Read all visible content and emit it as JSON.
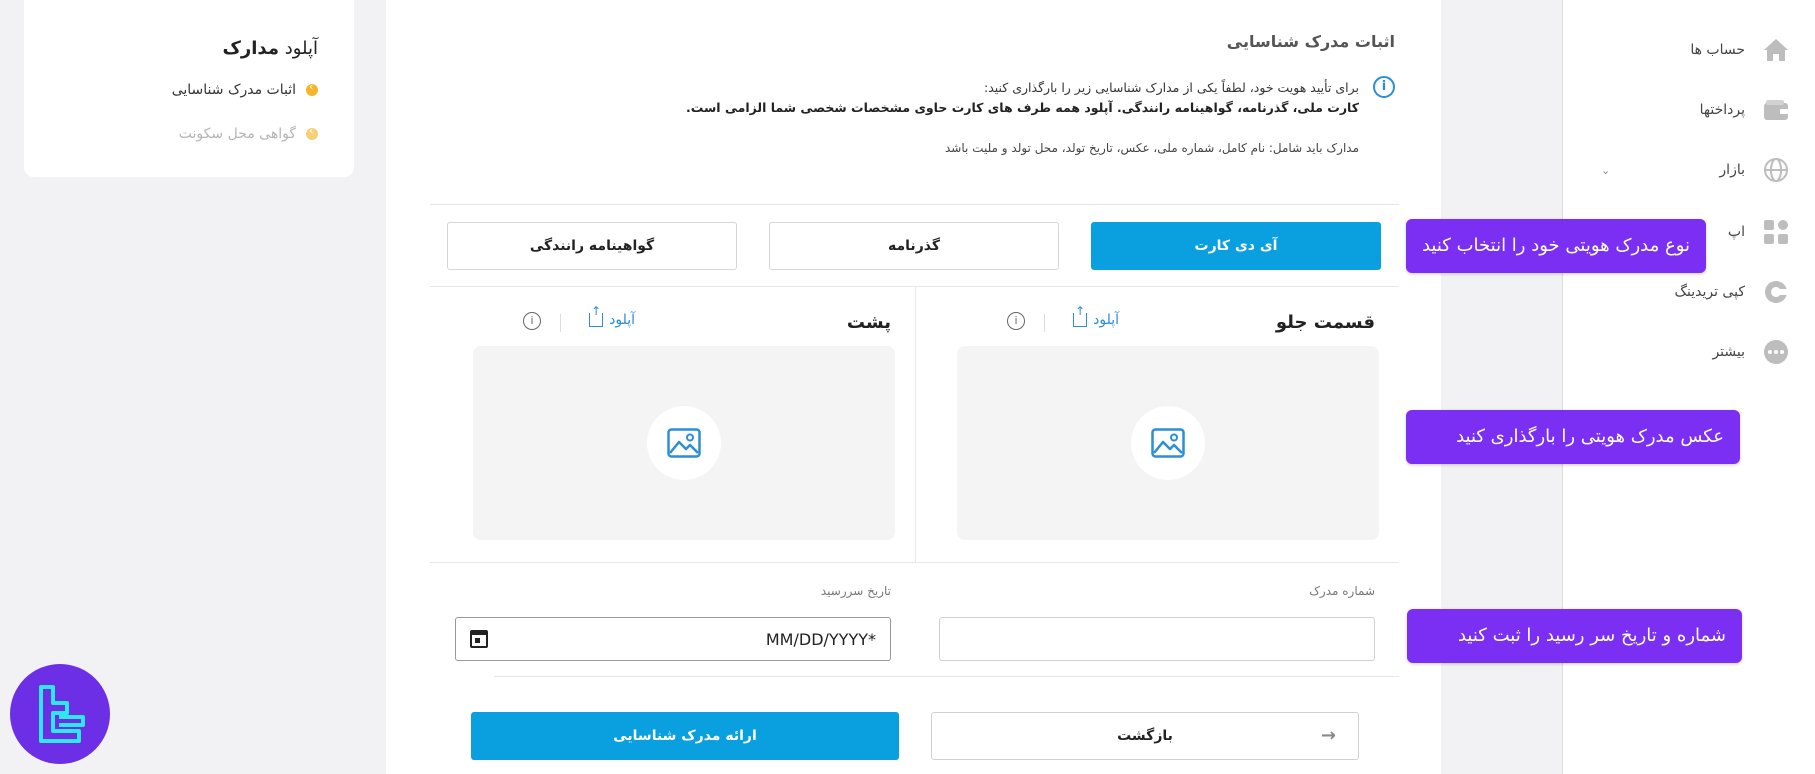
{
  "left_card": {
    "title_light": "آپلود",
    "title_bold": "مدارک",
    "steps": [
      {
        "label": "اثبات مدرک شناسایی",
        "state": "active"
      },
      {
        "label": "گواهی محل سکونت",
        "state": "pending"
      }
    ]
  },
  "main": {
    "title": "اثبات مدرک شناسایی",
    "info": {
      "line1": "برای تأیید هویت خود، لطفاً یکی از مدارک شناسایی زیر را بارگذاری کنید:",
      "line2": "کارت ملی، گذرنامه، گواهینامه رانندگی. آپلود همه طرف های کارت حاوی مشخصات شخصی شما الزامی است.",
      "line3": "مدارک باید شامل: نام کامل، شماره ملی، عکس، تاریخ تولد، محل تولد و ملیت باشد"
    },
    "doc_types": [
      {
        "label": "آی دی کارت",
        "selected": true
      },
      {
        "label": "گذرنامه",
        "selected": false
      },
      {
        "label": "گواهینامه رانندگی",
        "selected": false
      }
    ],
    "front": {
      "title": "قسمت جلو",
      "upload_label": "آپلود"
    },
    "back": {
      "title": "پشت",
      "upload_label": "آپلود"
    },
    "doc_number": {
      "label": "شماره مدرک",
      "value": ""
    },
    "expiry": {
      "label": "تاریخ سررسید",
      "placeholder": "MM/DD/YYYY*"
    },
    "submit_label": "ارائه مدرک شناسایی",
    "back_label": "بازگشت"
  },
  "nav": {
    "items": [
      {
        "label": "حساب ها",
        "icon": "home-icon"
      },
      {
        "label": "پرداختها",
        "icon": "wallet-icon"
      },
      {
        "label": "بازار",
        "icon": "globe-icon"
      },
      {
        "label": "اپ",
        "icon": "apps-icon"
      },
      {
        "label": "کپی تریدینگ",
        "icon": "copy-trading-icon"
      },
      {
        "label": "بیشتر",
        "icon": "more-icon"
      }
    ]
  },
  "annotations": {
    "select_doc": "نوع مدرک هویتی خود را انتخاب کنید",
    "upload_photo": "عکس مدرک هویتی را بارگذاری کنید",
    "enter_number_date": "شماره و تاریخ سر رسید را ثبت کنید"
  },
  "colors": {
    "primary": "#0aa0e0",
    "annotation": "#7b2ff2",
    "step_dot": "#f4b52a"
  }
}
